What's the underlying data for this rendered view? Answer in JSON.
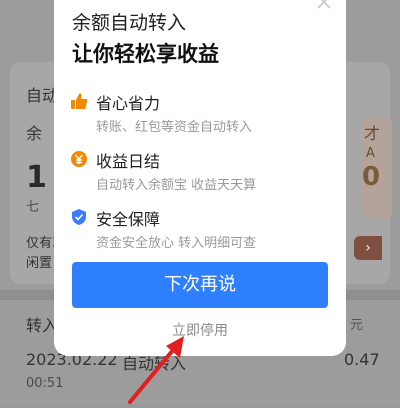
{
  "background": {
    "label_auto": "自动",
    "label_remaining": "余",
    "label_cai": "才",
    "big_digit": "1",
    "label_qi": "七",
    "label_right_A": "A",
    "label_right_num": "0",
    "only_prefix": "仅有3",
    "idle_prefix": "闲置",
    "pill_symbol": "›",
    "transfer_in": "转入",
    "yuan": "元",
    "record_date": "2023.02.22",
    "record_type": "自动转入",
    "record_time": "00:51",
    "record_amount": "0.47"
  },
  "modal": {
    "title_line1": "余额自动转入",
    "title_line2": "让你轻松享收益",
    "features": [
      {
        "icon": "thumbs-up-icon",
        "title": "省心省力",
        "desc": "转账、红包等资金自动转入"
      },
      {
        "icon": "coin-icon",
        "title": "收益日结",
        "desc": "自动转入余额宝 收益天天算"
      },
      {
        "icon": "shield-icon",
        "title": "安全保障",
        "desc": "资金安全放心 转入明细可查"
      }
    ],
    "primary_label": "下次再说",
    "secondary_label": "立即停用"
  },
  "colors": {
    "primary": "#2f80ff",
    "accent_orange": "#f08a00",
    "shield_blue": "#3a7bff",
    "annotation_red": "#e02020"
  }
}
